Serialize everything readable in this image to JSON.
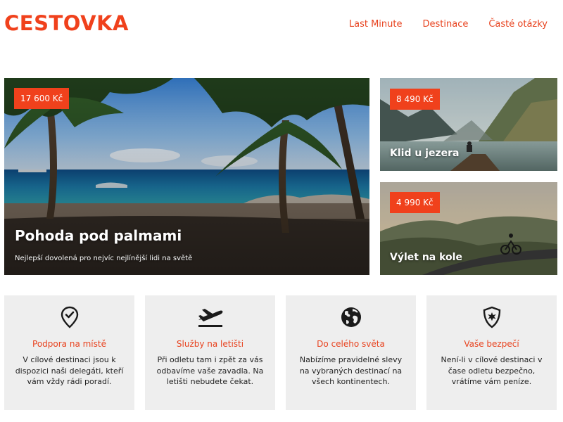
{
  "header": {
    "logo": "CESTOVKA",
    "nav": [
      "Last Minute",
      "Destinace",
      "Časté otázky"
    ]
  },
  "tiles": {
    "main": {
      "price": "17 600 Kč",
      "title": "Pohoda pod palmami",
      "subtitle": "Nejlepší dovolená pro nejvíc nejlínější lidi na světě"
    },
    "lake": {
      "price": "8 490 Kč",
      "title": "Klid u jezera"
    },
    "bike": {
      "price": "4 990 Kč",
      "title": "Výlet na kole"
    }
  },
  "features": [
    {
      "icon": "location-check-icon",
      "title": "Podpora na místě",
      "text": "V cílové destinaci jsou k dispozici naši delegáti, kteří vám vždy rádi poradí."
    },
    {
      "icon": "airplane-departure-icon",
      "title": "Služby na letišti",
      "text": "Při odletu tam i zpět za vás odbavíme vaše zavadla. Na letišti nebudete čekat."
    },
    {
      "icon": "globe-icon",
      "title": "Do celého světa",
      "text": "Nabízíme pravidelné slevy na vybraných destinací na všech kontinentech."
    },
    {
      "icon": "shield-icon",
      "title": "Vaše bezpečí",
      "text": "Není-li v cílové destinaci v čase odletu bezpečno, vrátíme vám peníze."
    }
  ],
  "colors": {
    "accent": "#f0411c",
    "feature_bg": "#eeeeee"
  }
}
